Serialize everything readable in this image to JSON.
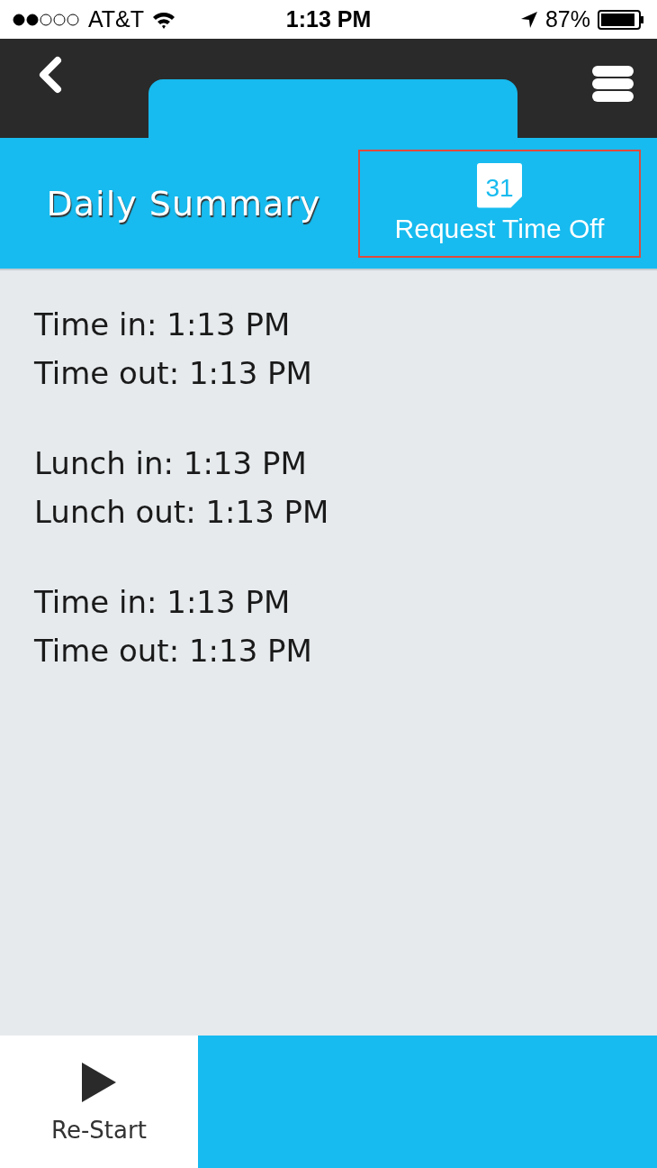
{
  "status_bar": {
    "carrier": "AT&T",
    "time": "1:13 PM",
    "battery": "87%"
  },
  "header": {
    "title": "Daily Summary",
    "action": {
      "label": "Request Time Off",
      "day": "31"
    }
  },
  "summary": [
    {
      "lines": [
        "Time in: 1:13 PM",
        "Time out: 1:13 PM"
      ]
    },
    {
      "lines": [
        "Lunch in: 1:13 PM",
        "Lunch out: 1:13 PM"
      ]
    },
    {
      "lines": [
        "Time in: 1:13 PM",
        "Time out: 1:13 PM"
      ]
    }
  ],
  "bottom_bar": {
    "button": "Re-Start"
  }
}
